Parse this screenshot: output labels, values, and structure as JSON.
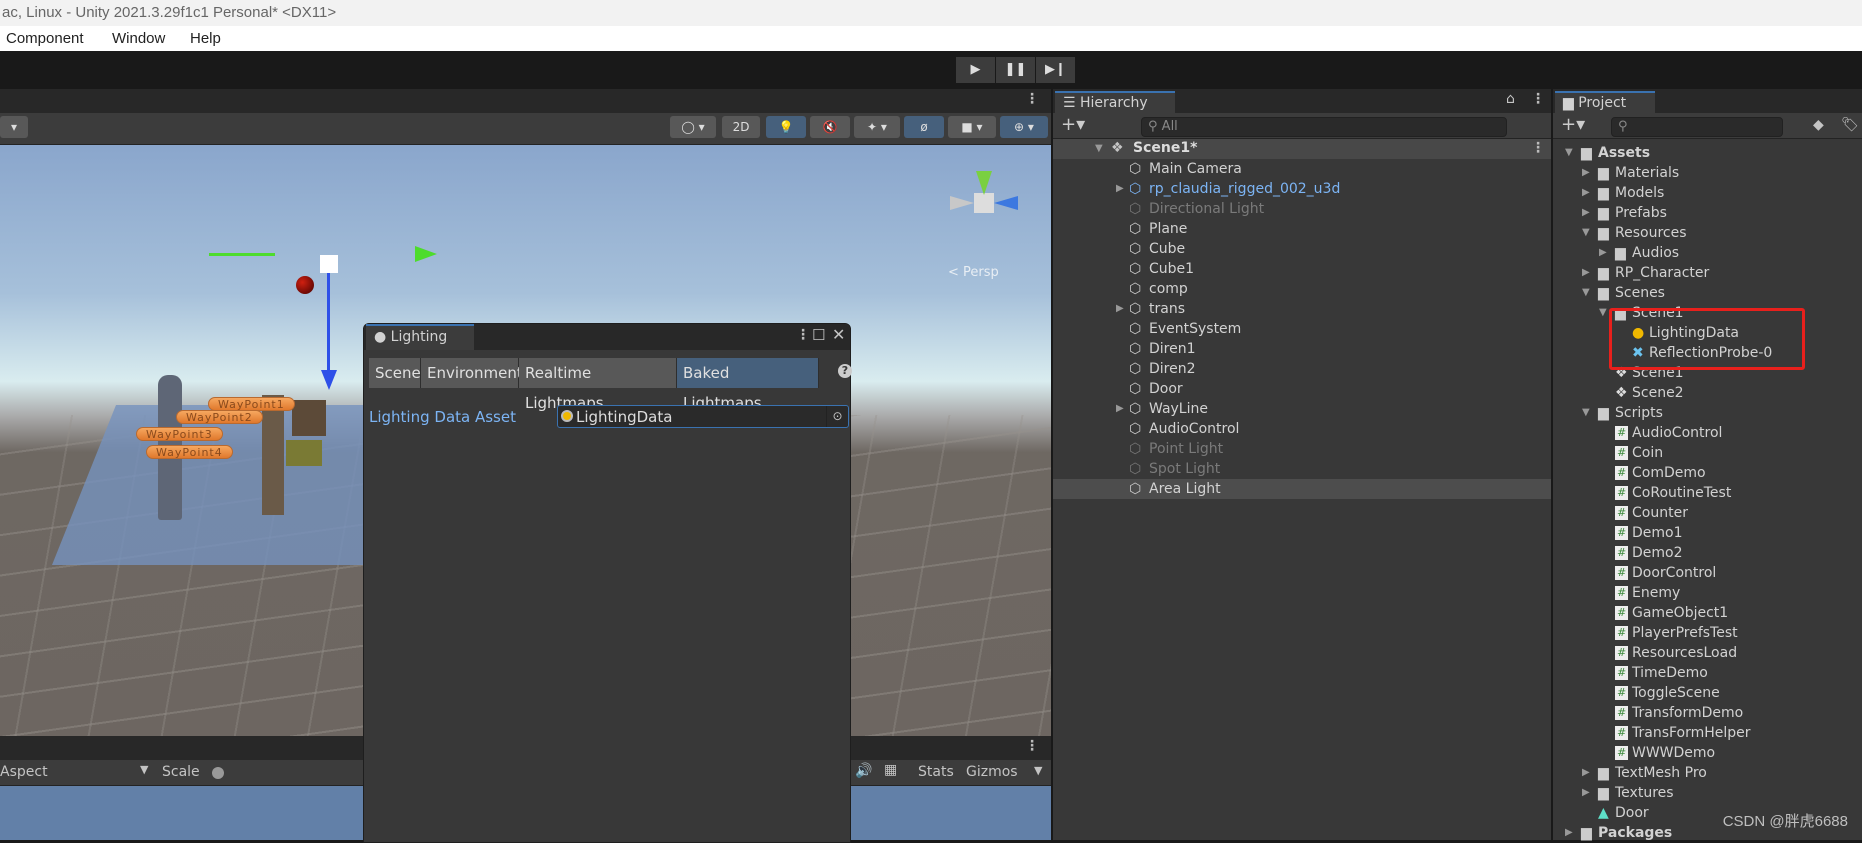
{
  "window": {
    "title": "ac, Linux - Unity 2021.3.29f1c1 Personal* <DX11>"
  },
  "menu": [
    "Component",
    "Window",
    "Help"
  ],
  "play_controls": {
    "play": "play-icon",
    "pause": "pause-icon",
    "step": "step-icon"
  },
  "scene_toolbar": {
    "btn_2d": "2D",
    "persp_label": "< Persp"
  },
  "scene_labels": [
    "WayPoint1",
    "WayPoint2",
    "WayPoint3",
    "WayPoint4"
  ],
  "game_toolbar": {
    "aspect": "Aspect",
    "scale": "Scale",
    "stats": "Stats",
    "gizmos": "Gizmos"
  },
  "hierarchy": {
    "tab": "Hierarchy",
    "search_placeholder": "All",
    "scene": "Scene1*",
    "items": [
      {
        "label": "Main Camera"
      },
      {
        "label": "rp_claudia_rigged_002_u3d",
        "arrow": true,
        "style": "prefab"
      },
      {
        "label": "Directional Light",
        "style": "disabled"
      },
      {
        "label": "Plane"
      },
      {
        "label": "Cube"
      },
      {
        "label": "Cube1"
      },
      {
        "label": "comp"
      },
      {
        "label": "trans",
        "arrow": true
      },
      {
        "label": "EventSystem"
      },
      {
        "label": "Diren1"
      },
      {
        "label": "Diren2"
      },
      {
        "label": "Door"
      },
      {
        "label": "WayLine",
        "arrow": true
      },
      {
        "label": "AudioControl"
      },
      {
        "label": "Point Light",
        "style": "disabled"
      },
      {
        "label": "Spot Light",
        "style": "disabled"
      },
      {
        "label": "Area Light",
        "selected": true
      }
    ]
  },
  "lighting": {
    "tab": "Lighting",
    "tabs": [
      "Scene",
      "Environment",
      "Realtime Lightmaps",
      "Baked Lightmaps"
    ],
    "active_tab": "Baked Lightmaps",
    "field_label": "Lighting Data Asset",
    "field_value": "LightingData"
  },
  "project": {
    "tab": "Project",
    "items": [
      {
        "label": "Assets",
        "depth": 0,
        "arrow": "open",
        "icon": "folder-open",
        "bold": true
      },
      {
        "label": "Materials",
        "depth": 1,
        "arrow": "closed",
        "icon": "folder"
      },
      {
        "label": "Models",
        "depth": 1,
        "arrow": "closed",
        "icon": "folder"
      },
      {
        "label": "Prefabs",
        "depth": 1,
        "arrow": "closed",
        "icon": "folder"
      },
      {
        "label": "Resources",
        "depth": 1,
        "arrow": "open",
        "icon": "folder-open"
      },
      {
        "label": "Audios",
        "depth": 2,
        "arrow": "closed",
        "icon": "folder"
      },
      {
        "label": "RP_Character",
        "depth": 1,
        "arrow": "closed",
        "icon": "folder"
      },
      {
        "label": "Scenes",
        "depth": 1,
        "arrow": "open",
        "icon": "folder-open"
      },
      {
        "label": "Scene1",
        "depth": 2,
        "arrow": "open",
        "icon": "folder-open"
      },
      {
        "label": "LightingData",
        "depth": 3,
        "icon": "lighting-data"
      },
      {
        "label": "ReflectionProbe-0",
        "depth": 3,
        "icon": "reflection-probe"
      },
      {
        "label": "Scene1",
        "depth": 2,
        "icon": "unity-scene"
      },
      {
        "label": "Scene2",
        "depth": 2,
        "icon": "unity-scene"
      },
      {
        "label": "Scripts",
        "depth": 1,
        "arrow": "open",
        "icon": "folder-open"
      },
      {
        "label": "AudioControl",
        "depth": 2,
        "icon": "script"
      },
      {
        "label": "Coin",
        "depth": 2,
        "icon": "script"
      },
      {
        "label": "ComDemo",
        "depth": 2,
        "icon": "script"
      },
      {
        "label": "CoRoutineTest",
        "depth": 2,
        "icon": "script"
      },
      {
        "label": "Counter",
        "depth": 2,
        "icon": "script"
      },
      {
        "label": "Demo1",
        "depth": 2,
        "icon": "script"
      },
      {
        "label": "Demo2",
        "depth": 2,
        "icon": "script"
      },
      {
        "label": "DoorControl",
        "depth": 2,
        "icon": "script"
      },
      {
        "label": "Enemy",
        "depth": 2,
        "icon": "script"
      },
      {
        "label": "GameObject1",
        "depth": 2,
        "icon": "script"
      },
      {
        "label": "PlayerPrefsTest",
        "depth": 2,
        "icon": "script"
      },
      {
        "label": "ResourcesLoad",
        "depth": 2,
        "icon": "script"
      },
      {
        "label": "TimeDemo",
        "depth": 2,
        "icon": "script"
      },
      {
        "label": "ToggleScene",
        "depth": 2,
        "icon": "script"
      },
      {
        "label": "TransformDemo",
        "depth": 2,
        "icon": "script"
      },
      {
        "label": "TransFormHelper",
        "depth": 2,
        "icon": "script"
      },
      {
        "label": "WWWDemo",
        "depth": 2,
        "icon": "script"
      },
      {
        "label": "TextMesh Pro",
        "depth": 1,
        "arrow": "closed",
        "icon": "folder"
      },
      {
        "label": "Textures",
        "depth": 1,
        "arrow": "closed",
        "icon": "folder"
      },
      {
        "label": "Door",
        "depth": 1,
        "icon": "animation"
      },
      {
        "label": "Packages",
        "depth": 0,
        "arrow": "closed",
        "icon": "folder",
        "bold": true
      }
    ]
  },
  "watermark": "CSDN @胖虎6688",
  "colors": {
    "accent": "#3a72b0",
    "selected_tab": "#46607c",
    "prefab_text": "#7cb4f4",
    "highlight_box": "#e8201c"
  }
}
